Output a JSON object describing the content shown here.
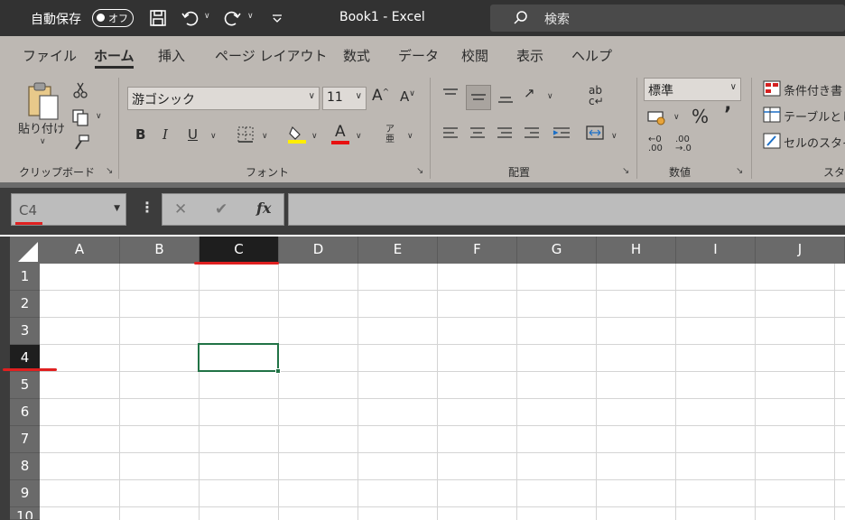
{
  "titlebar": {
    "autosave_label": "自動保存",
    "autosave_state": "オフ",
    "doc_title": "Book1  -  Excel",
    "search_placeholder": "検索"
  },
  "tabs": [
    "ファイル",
    "ホーム",
    "挿入",
    "ページ レイアウト",
    "数式",
    "データ",
    "校閲",
    "表示",
    "ヘルプ"
  ],
  "active_tab": "ホーム",
  "ribbon": {
    "clipboard": {
      "paste_label": "貼り付け",
      "group_label": "クリップボード"
    },
    "font": {
      "font_name": "游ゴシック",
      "font_size": "11",
      "group_label": "フォント"
    },
    "alignment": {
      "group_label": "配置"
    },
    "number": {
      "format": "標準",
      "group_label": "数値"
    },
    "styles": {
      "conditional": "条件付き書",
      "table": "テーブルとし",
      "cell_styles": "セルのスタイ",
      "group_label": "スタ"
    }
  },
  "formula_bar": {
    "name_box": "C4",
    "formula": ""
  },
  "sheet": {
    "columns": [
      "A",
      "B",
      "C",
      "D",
      "E",
      "F",
      "G",
      "H",
      "I",
      "J"
    ],
    "rows": [
      "1",
      "2",
      "3",
      "4",
      "5",
      "6",
      "7",
      "8",
      "9",
      "10"
    ],
    "selected_column": "C",
    "selected_row": "4",
    "active_cell": "C4"
  },
  "colors": {
    "titlebar": "#323232",
    "ribbon": "#bdb8b3",
    "header": "#6a6a6a",
    "selected_header": "#1e1e1e",
    "active_cell_border": "#217346",
    "annotation": "#e02020"
  },
  "icons": [
    "save-icon",
    "undo-icon",
    "redo-icon",
    "search-icon",
    "paste-icon",
    "cut-icon",
    "copy-icon",
    "format-painter-icon"
  ]
}
